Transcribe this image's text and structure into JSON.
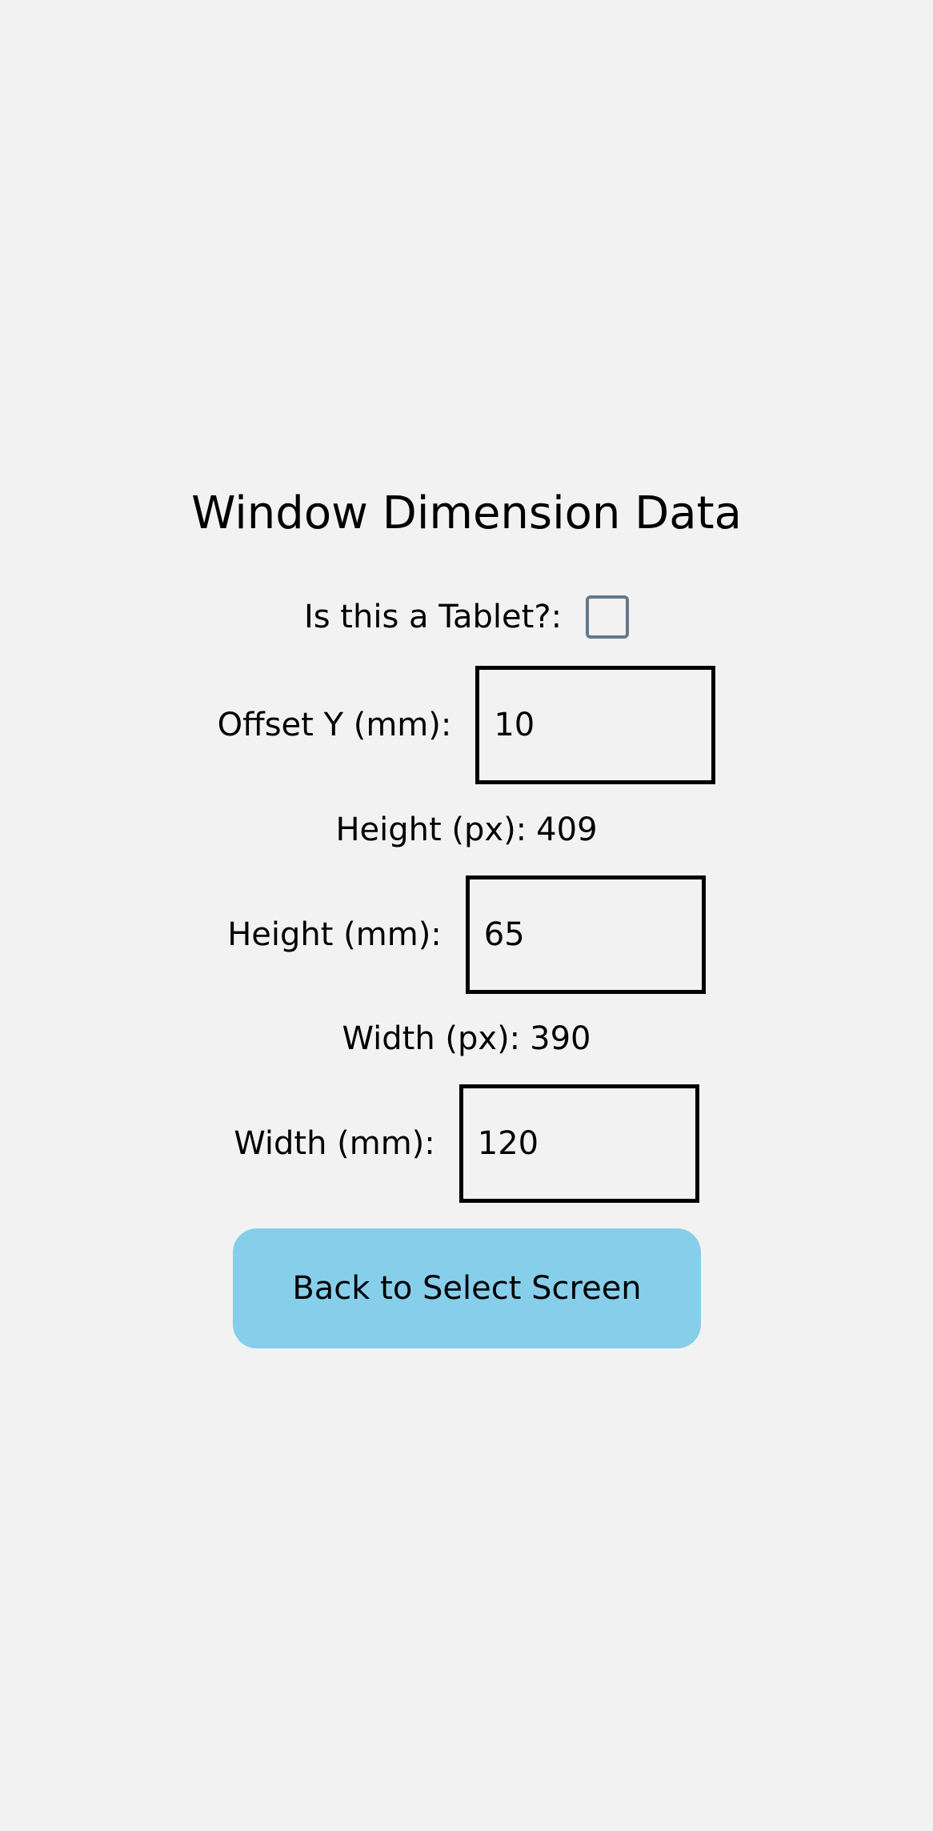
{
  "title": "Window Dimension Data",
  "tablet": {
    "label": "Is this a Tablet?:",
    "checked": false
  },
  "offset_y": {
    "label": "Offset Y (mm):",
    "value": "10"
  },
  "height_px": {
    "label": "Height (px):",
    "value": "409"
  },
  "height_mm": {
    "label": "Height (mm):",
    "value": "65"
  },
  "width_px": {
    "label": "Width (px):",
    "value": "390"
  },
  "width_mm": {
    "label": "Width (mm):",
    "value": "120"
  },
  "back_button": {
    "label": "Back to Select Screen",
    "color": "#87ceeb"
  }
}
